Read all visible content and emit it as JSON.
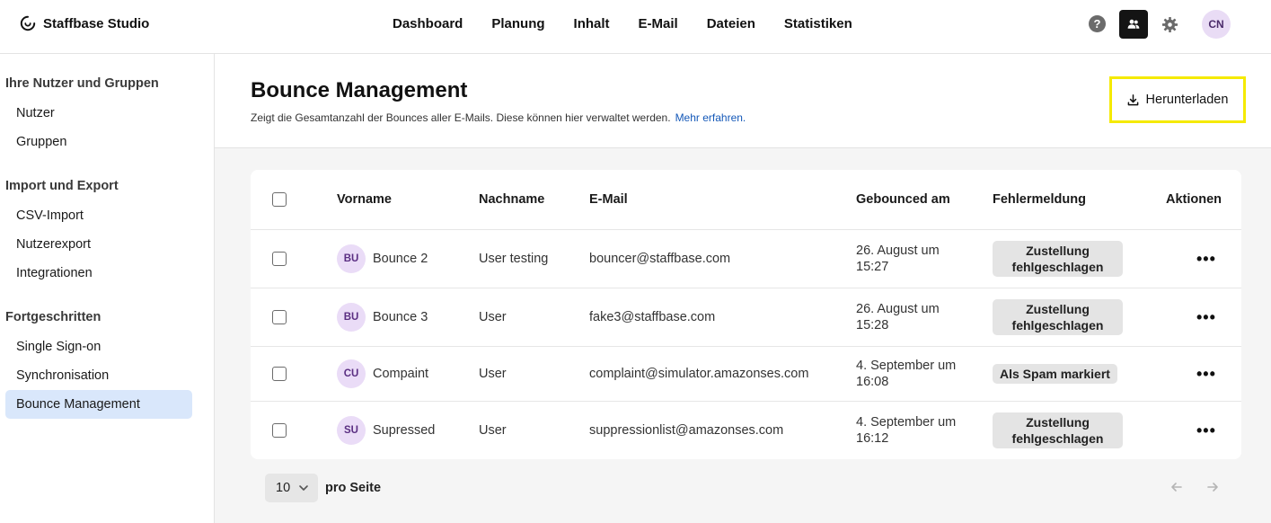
{
  "app": {
    "brand": "Staffbase Studio"
  },
  "nav": [
    "Dashboard",
    "Planung",
    "Inhalt",
    "E-Mail",
    "Dateien",
    "Statistiken"
  ],
  "top_actions": {
    "avatar_initials": "CN",
    "help_icon": "help-icon",
    "users_icon": "users-icon",
    "settings_icon": "gear-icon"
  },
  "sidebar": {
    "groups": [
      {
        "title": "Ihre Nutzer und Gruppen",
        "items": [
          "Nutzer",
          "Gruppen"
        ]
      },
      {
        "title": "Import und Export",
        "items": [
          "CSV-Import",
          "Nutzerexport",
          "Integrationen"
        ]
      },
      {
        "title": "Fortgeschritten",
        "items": [
          "Single Sign-on",
          "Synchronisation",
          "Bounce Management"
        ]
      }
    ],
    "active_item": "Bounce Management"
  },
  "page": {
    "title": "Bounce Management",
    "description": "Zeigt die Gesamtanzahl der Bounces aller E-Mails. Diese können hier verwaltet werden.",
    "learn_more": "Mehr erfahren.",
    "download_label": "Herunterladen"
  },
  "table": {
    "columns": [
      "Vorname",
      "Nachname",
      "E-Mail",
      "Gebounced am",
      "Fehlermeldung",
      "Aktionen"
    ],
    "rows": [
      {
        "initials": "BU",
        "first_name": "Bounce 2",
        "last_name": "User testing",
        "email": "bouncer@staffbase.com",
        "bounced_at": "26. August um 15:27",
        "error": "Zustellung fehlgeschlagen"
      },
      {
        "initials": "BU",
        "first_name": "Bounce 3",
        "last_name": "User",
        "email": "fake3@staffbase.com",
        "bounced_at": "26. August um 15:28",
        "error": "Zustellung fehlgeschlagen"
      },
      {
        "initials": "CU",
        "first_name": "Compaint",
        "last_name": "User",
        "email": "complaint@simulator.amazonses.com",
        "bounced_at": "4. September um 16:08",
        "error": "Als Spam markiert"
      },
      {
        "initials": "SU",
        "first_name": "Supressed",
        "last_name": "User",
        "email": "suppressionlist@amazonses.com",
        "bounced_at": "4. September um 16:12",
        "error": "Zustellung fehlgeschlagen"
      }
    ]
  },
  "pagination": {
    "per_page_value": "10",
    "per_page_label": "pro Seite"
  }
}
